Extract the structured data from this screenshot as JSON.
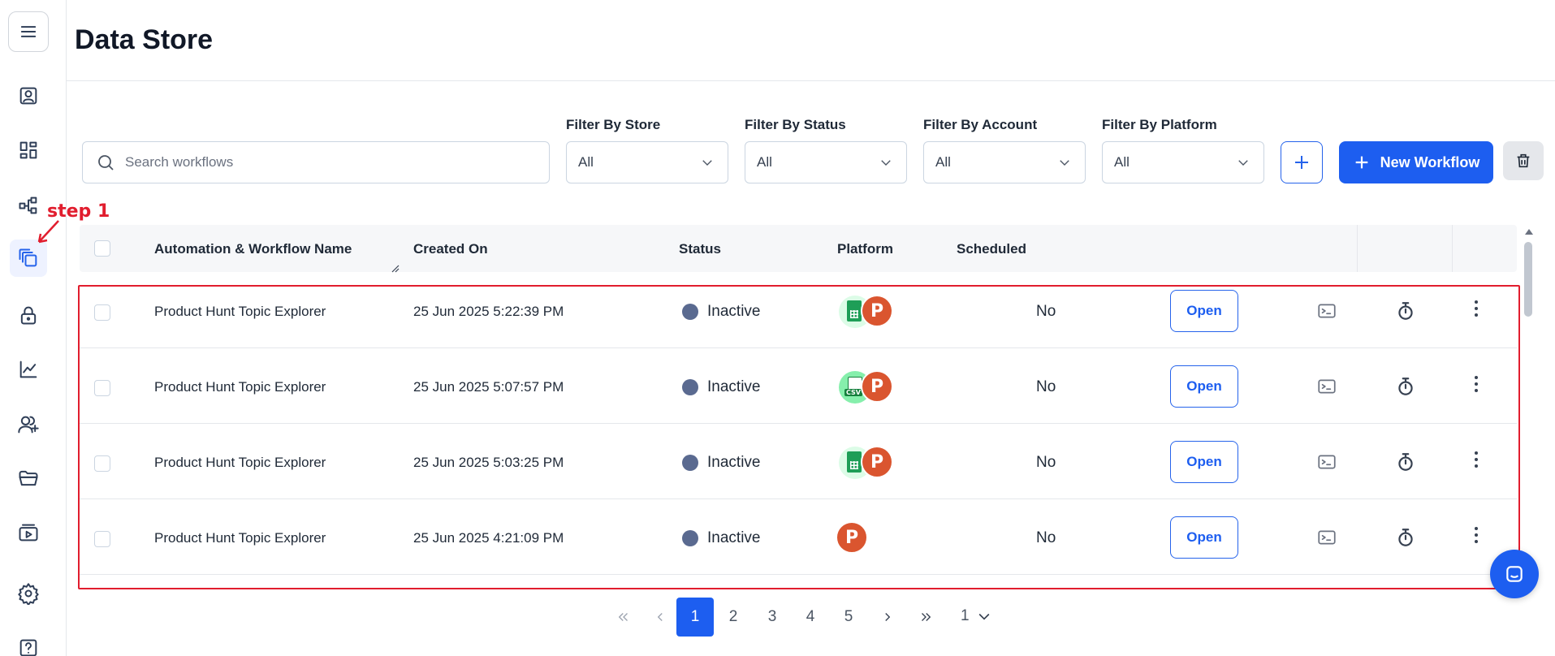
{
  "page": {
    "title": "Data Store"
  },
  "sidebar": {
    "items": [
      {
        "name": "menu-icon"
      },
      {
        "name": "contact-card-icon"
      },
      {
        "name": "dashboard-icon"
      },
      {
        "name": "workflow-icon"
      },
      {
        "name": "data-store-icon",
        "active": true
      },
      {
        "name": "lock-icon"
      },
      {
        "name": "analytics-icon"
      },
      {
        "name": "add-user-icon"
      },
      {
        "name": "folder-icon"
      },
      {
        "name": "media-icon"
      },
      {
        "name": "settings-icon"
      },
      {
        "name": "help-icon"
      }
    ]
  },
  "annotation": {
    "label": "step 1",
    "color": "#e11d2e"
  },
  "toolbar": {
    "search_placeholder": "Search workflows",
    "filters": [
      {
        "label": "Filter By Store",
        "value": "All"
      },
      {
        "label": "Filter By Status",
        "value": "All"
      },
      {
        "label": "Filter By Account",
        "value": "All"
      },
      {
        "label": "Filter By Platform",
        "value": "All"
      }
    ],
    "new_workflow_label": "New Workflow",
    "accent": "#1d5ef0"
  },
  "table": {
    "headers": {
      "name": "Automation & Workflow Name",
      "created": "Created On",
      "status": "Status",
      "platform": "Platform",
      "scheduled": "Scheduled"
    },
    "open_label": "Open",
    "rows": [
      {
        "name": "Product Hunt Topic Explorer",
        "created": "25 Jun 2025 5:22:39 PM",
        "status": "Inactive",
        "platforms": [
          "google-sheets-icon",
          "product-hunt-icon"
        ],
        "scheduled": "No"
      },
      {
        "name": "Product Hunt Topic Explorer",
        "created": "25 Jun 2025 5:07:57 PM",
        "status": "Inactive",
        "platforms": [
          "csv-file-icon",
          "product-hunt-icon"
        ],
        "scheduled": "No",
        "csv_tag": "CSV"
      },
      {
        "name": "Product Hunt Topic Explorer",
        "created": "25 Jun 2025 5:03:25 PM",
        "status": "Inactive",
        "platforms": [
          "google-sheets-icon",
          "product-hunt-icon"
        ],
        "scheduled": "No"
      },
      {
        "name": "Product Hunt Topic Explorer",
        "created": "25 Jun 2025 4:21:09 PM",
        "status": "Inactive",
        "platforms": [
          "product-hunt-icon"
        ],
        "scheduled": "No"
      }
    ],
    "product_hunt_letter": "P",
    "status_color": "#5a6a90",
    "highlight_color": "#e11d2e"
  },
  "pagination": {
    "pages": [
      "1",
      "2",
      "3",
      "4",
      "5"
    ],
    "current": "1",
    "page_size": "1"
  }
}
